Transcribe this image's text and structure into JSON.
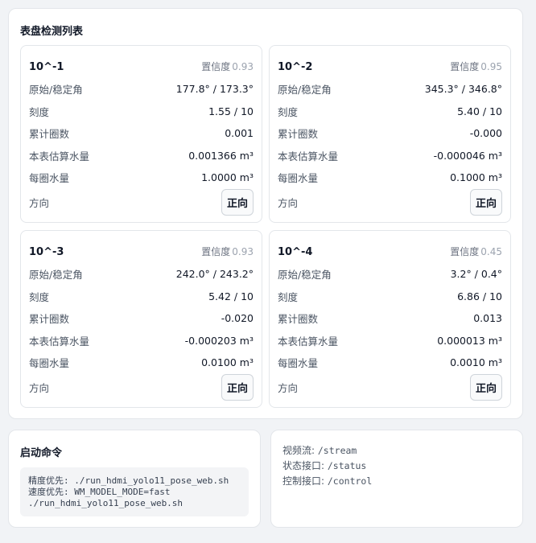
{
  "meter_panel": {
    "title": "表盘检测列表",
    "conf_label": "置信度",
    "labels": {
      "angle": "原始/稳定角",
      "scale": "刻度",
      "turns": "累计圈数",
      "volume": "本表估算水量",
      "per_turn": "每圈水量",
      "direction": "方向"
    },
    "cards": [
      {
        "name": "10^-1",
        "confidence": "0.93",
        "angle": "177.8° / 173.3°",
        "scale": "1.55 / 10",
        "turns": "0.001",
        "volume": "0.001366 m³",
        "per_turn": "1.0000 m³",
        "direction_button": "正向"
      },
      {
        "name": "10^-2",
        "confidence": "0.95",
        "angle": "345.3° / 346.8°",
        "scale": "5.40 / 10",
        "turns": "-0.000",
        "volume": "-0.000046 m³",
        "per_turn": "0.1000 m³",
        "direction_button": "正向"
      },
      {
        "name": "10^-3",
        "confidence": "0.93",
        "angle": "242.0° / 243.2°",
        "scale": "5.42 / 10",
        "turns": "-0.020",
        "volume": "-0.000203 m³",
        "per_turn": "0.0100 m³",
        "direction_button": "正向"
      },
      {
        "name": "10^-4",
        "confidence": "0.45",
        "angle": "3.2° / 0.4°",
        "scale": "6.86 / 10",
        "turns": "0.013",
        "volume": "0.000013 m³",
        "per_turn": "0.0010 m³",
        "direction_button": "正向"
      }
    ]
  },
  "command_panel": {
    "title": "启动命令",
    "lines": [
      "精度优先: ./run_hdmi_yolo11_pose_web.sh",
      "速度优先: WM_MODEL_MODE=fast",
      "./run_hdmi_yolo11_pose_web.sh"
    ]
  },
  "endpoints": [
    {
      "label": "视频流:",
      "path": "/stream"
    },
    {
      "label": "状态接口:",
      "path": "/status"
    },
    {
      "label": "控制接口:",
      "path": "/control"
    }
  ]
}
